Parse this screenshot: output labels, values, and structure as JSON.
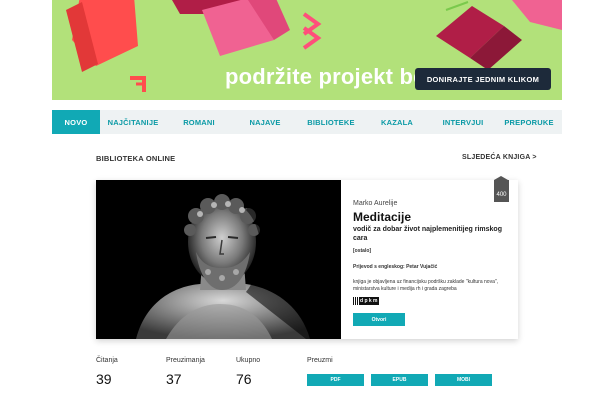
{
  "banner": {
    "text": "podržite projekt bek",
    "donate_label": "DONIRAJTE JEDNIM KLIKOM",
    "background": "#b2e17a"
  },
  "nav": {
    "items": [
      {
        "label": "NOVO",
        "active": true
      },
      {
        "label": "NAJČITANIJE"
      },
      {
        "label": "ROMANI"
      },
      {
        "label": "NAJAVE"
      },
      {
        "label": "BIBLIOTEKE"
      },
      {
        "label": "KAZALA"
      },
      {
        "label": "INTERVJUI"
      },
      {
        "label": "PREPORUKE"
      }
    ],
    "accent": "#11a9b5"
  },
  "section": {
    "label": "BIBLIOTEKA ONLINE",
    "next_label": "SLJEDEĆA KNJIGA >"
  },
  "book": {
    "author": "Marko Aurelije",
    "title": "Meditacije",
    "subtitle": "vodič za dobar život najplemenitijeg rimskog cara",
    "tag": "[ostalo]",
    "translator": "Prijevod s engleskog: Petar Vujačić",
    "note": "knjiga je objavljena uz financijsku podršku zaklade \"kultura nova\", ministarstva kulture i medija rh i grada zagreba",
    "logo_text": "d p k m",
    "open_label": "Otvori",
    "pages": "400"
  },
  "stats": {
    "reads_label": "Čitanja",
    "reads": "39",
    "downloads_label": "Preuzimanja",
    "downloads": "37",
    "total_label": "Ukupno",
    "total": "76"
  },
  "download": {
    "label": "Preuzmi",
    "formats": [
      "PDF",
      "EPUB",
      "MOBI"
    ]
  }
}
